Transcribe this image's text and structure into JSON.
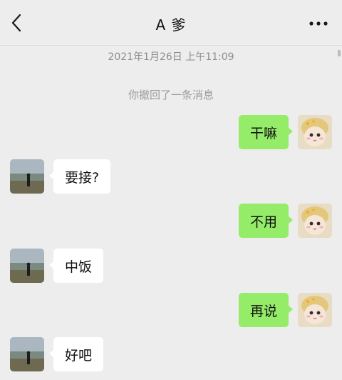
{
  "header": {
    "title": "A 爹",
    "back_icon": "chevron-left-icon",
    "more_icon": "more-dots-icon"
  },
  "timestamp": "2021年1月26日 上午11:09",
  "system_note": "你撤回了一条消息",
  "messages": [
    {
      "side": "out",
      "text": "干嘛"
    },
    {
      "side": "in",
      "text": "要接?"
    },
    {
      "side": "out",
      "text": "不用"
    },
    {
      "side": "in",
      "text": "中饭"
    },
    {
      "side": "out",
      "text": "再说"
    },
    {
      "side": "in",
      "text": "好吧"
    }
  ],
  "colors": {
    "background": "#ededed",
    "outgoing_bubble": "#95ec69",
    "incoming_bubble": "#ffffff",
    "muted_text": "#8c8c8c"
  }
}
